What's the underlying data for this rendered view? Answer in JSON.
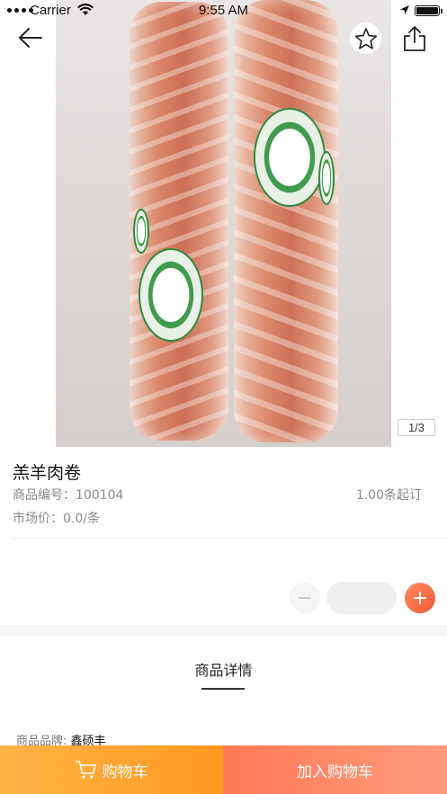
{
  "status_bar": {
    "carrier": "Carrier",
    "time": "9:55 AM",
    "battery_level": 1.0
  },
  "gallery": {
    "page_indicator": "1/3",
    "icons": {
      "back": "arrow-left-icon",
      "favorite": "star-outline-icon",
      "share": "share-icon"
    }
  },
  "product": {
    "name": "羔羊肉卷",
    "code_label": "商品编号：",
    "code": "100104",
    "moq": "1.00条起订",
    "market_price_label": "市场价：",
    "market_price": "0.0/条"
  },
  "stepper": {
    "minus": "−",
    "plus": "+",
    "quantity": ""
  },
  "details": {
    "title": "商品详情",
    "brand_label": "商品品牌: ",
    "brand_value": "鑫硕丰"
  },
  "bottom_bar": {
    "cart_label": "购物车",
    "add_to_cart_label": "加入购物车",
    "cart_color": "#ff9f2a",
    "add_color": "#ff8263"
  }
}
